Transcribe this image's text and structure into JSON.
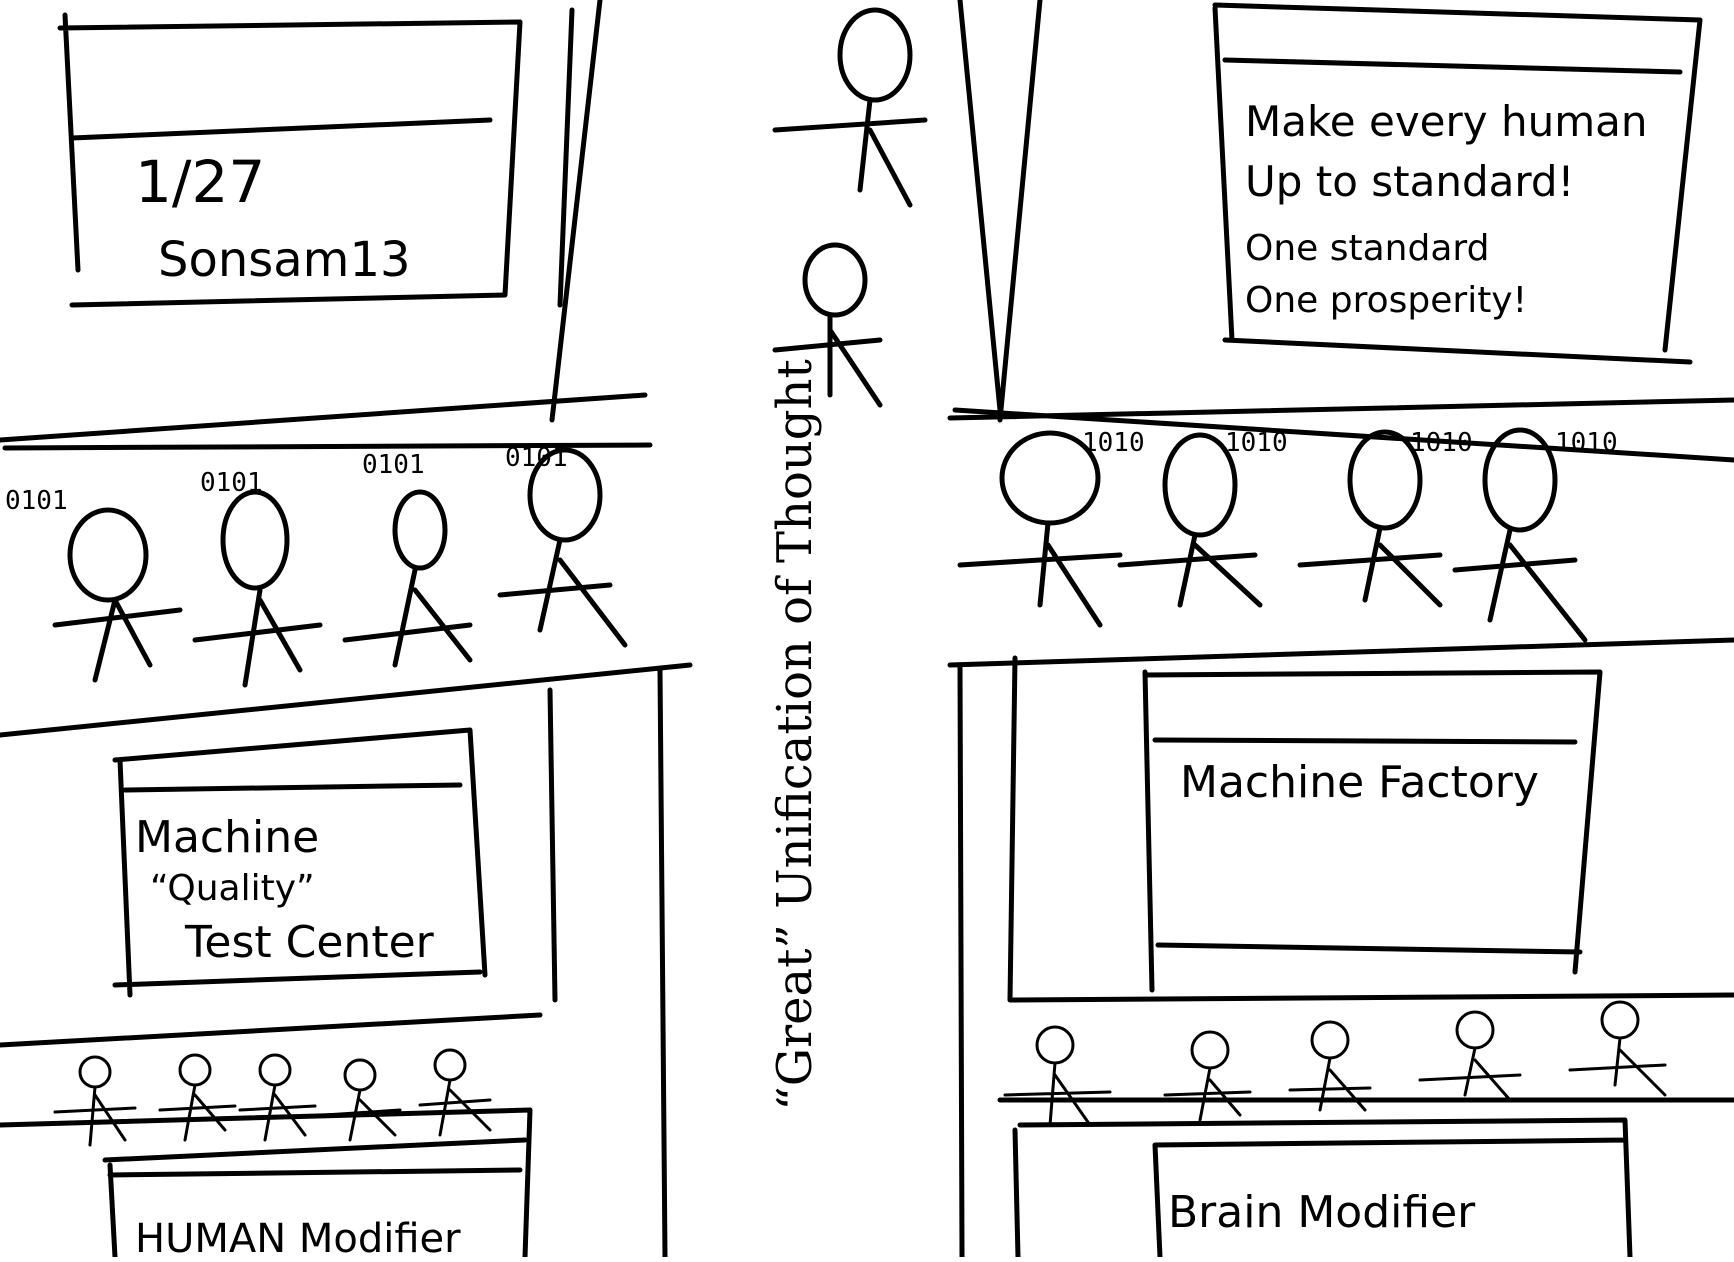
{
  "panels": {
    "top_left_sign": {
      "line1": "1/27",
      "line2": "Sonsam13"
    },
    "top_right_sign": {
      "line1": "Make every human",
      "line2": "Up to standard!",
      "line3": "One standard",
      "line4": "One prosperity!"
    },
    "quality_center": {
      "line1": "Machine",
      "line2": "“Quality”",
      "line3": "Test Center"
    },
    "human_modifier": {
      "label": "HUMAN Modifier"
    },
    "machine_factory": {
      "label": "Machine Factory"
    },
    "brain_modifier": {
      "label": "Brain Modifier"
    }
  },
  "center_title": "“Great” Unification of Thought",
  "binary_tags": {
    "left": [
      "0101",
      "0101",
      "0101",
      "0101"
    ],
    "right": [
      "1010",
      "1010",
      "1010",
      "1010"
    ]
  },
  "colors": {
    "ink": "#000000",
    "paper": "#ffffff"
  }
}
